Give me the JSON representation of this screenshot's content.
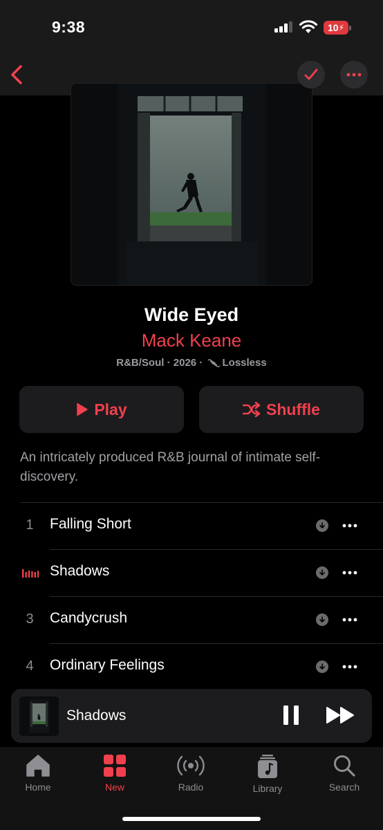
{
  "status_bar": {
    "time": "9:38",
    "battery": "10"
  },
  "album": {
    "title": "Wide Eyed",
    "artist": "Mack Keane",
    "genre": "R&B/Soul",
    "year": "2026",
    "quality": "Lossless",
    "separator": " · ",
    "description": "An intricately produced R&B journal of intimate self-discovery."
  },
  "actions": {
    "play_label": "Play",
    "shuffle_label": "Shuffle"
  },
  "tracks": [
    {
      "number": "1",
      "title": "Falling Short",
      "playing": false
    },
    {
      "number": "",
      "title": "Shadows",
      "playing": true
    },
    {
      "number": "3",
      "title": "Candycrush",
      "playing": false
    },
    {
      "number": "4",
      "title": "Ordinary Feelings",
      "playing": false
    }
  ],
  "now_playing": {
    "title": "Shadows"
  },
  "tabs": [
    {
      "label": "Home",
      "icon": "home-icon",
      "active": false
    },
    {
      "label": "New",
      "icon": "grid-icon",
      "active": true
    },
    {
      "label": "Radio",
      "icon": "radio-icon",
      "active": false
    },
    {
      "label": "Library",
      "icon": "library-icon",
      "active": false
    },
    {
      "label": "Search",
      "icon": "search-icon",
      "active": false
    }
  ],
  "colors": {
    "accent": "#f0404e",
    "background": "#000000",
    "surface": "#1c1c1e"
  }
}
